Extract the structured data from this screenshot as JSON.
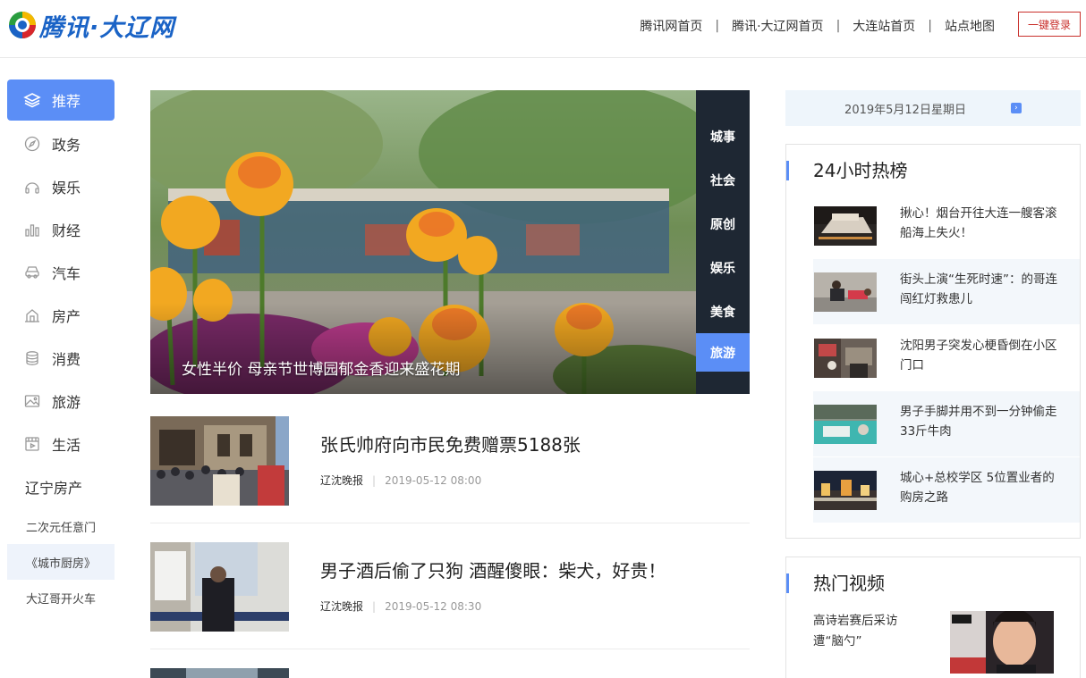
{
  "header": {
    "logo_text": "腾讯·大辽网",
    "nav": [
      "腾讯网首页",
      "腾讯·大辽网首页",
      "大连站首页",
      "站点地图"
    ],
    "nav_sep": "|",
    "login_label": "一键登录"
  },
  "sidebar": {
    "items": [
      {
        "label": "推荐",
        "icon": "layers-icon"
      },
      {
        "label": "政务",
        "icon": "compass-icon"
      },
      {
        "label": "娱乐",
        "icon": "headphones-icon"
      },
      {
        "label": "财经",
        "icon": "bar-chart-icon"
      },
      {
        "label": "汽车",
        "icon": "car-icon"
      },
      {
        "label": "房产",
        "icon": "building-icon"
      },
      {
        "label": "消费",
        "icon": "coins-icon"
      },
      {
        "label": "旅游",
        "icon": "picture-icon"
      },
      {
        "label": "生活",
        "icon": "film-icon"
      }
    ],
    "text_item": "辽宁房产",
    "small_items": [
      "二次元任意门",
      "《城市厨房》",
      "大辽哥开火车"
    ]
  },
  "hero": {
    "caption": "女性半价 母亲节世博园郁金香迎来盛花期",
    "tabs": [
      "城事",
      "社会",
      "原创",
      "娱乐",
      "美食",
      "旅游"
    ],
    "active_tab": "旅游"
  },
  "news": [
    {
      "title": "张氏帅府向市民免费赠票5188张",
      "source": "辽沈晚报",
      "time": "2019-05-12 08:00"
    },
    {
      "title": "男子酒后偷了只狗 酒醒傻眼：柴犬，好贵！",
      "source": "辽沈晚报",
      "time": "2019-05-12 08:30"
    }
  ],
  "news_meta_sep": "|",
  "right": {
    "date": "2019年5月12日星期日",
    "date_arrow": "›",
    "hot_title": "24小时热榜",
    "hot": [
      "揪心！烟台开往大连一艘客滚船海上失火！",
      "街头上演“生死时速”：的哥连闯红灯救患儿",
      "沈阳男子突发心梗昏倒在小区门口",
      "男子手脚并用不到一分钟偷走33斤牛肉",
      "城心+总校学区 5位置业者的购房之路"
    ],
    "video_title": "热门视频",
    "video": "高诗岩赛后采访遭“脑勺”"
  },
  "colors": {
    "accent": "#5b8ef6",
    "logo": "#1a63c6",
    "login": "#c9302c",
    "dark_tab": "#1e2733"
  }
}
